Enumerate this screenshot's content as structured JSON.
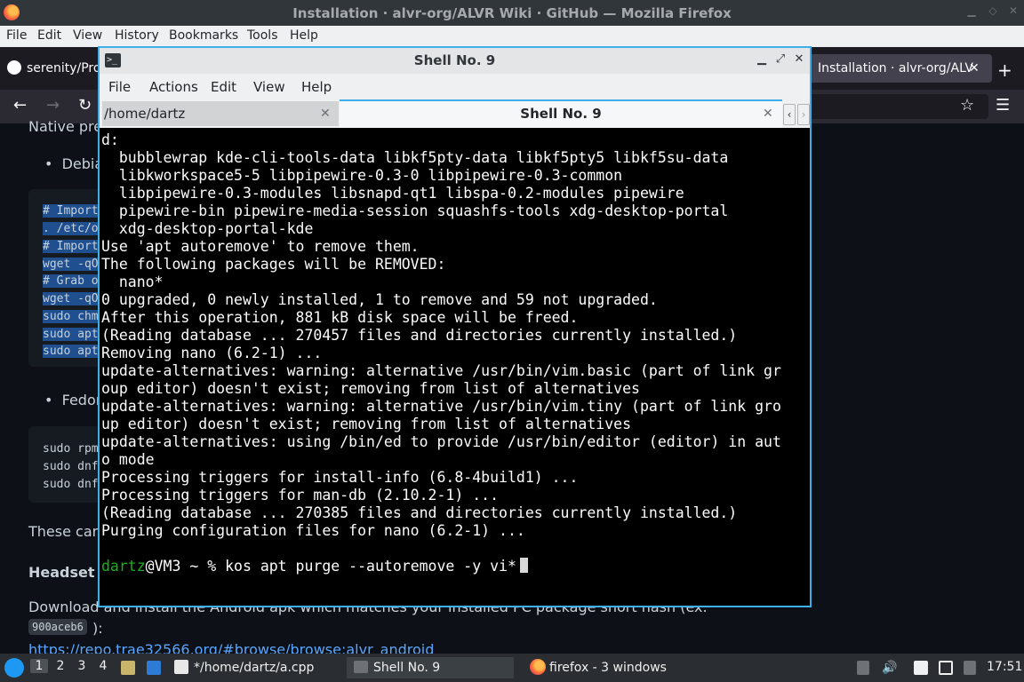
{
  "firefox": {
    "title": "Installation · alvr-org/ALVR Wiki · GitHub — Mozilla Firefox",
    "menu": [
      "File",
      "Edit",
      "View",
      "History",
      "Bookmarks",
      "Tools",
      "Help"
    ],
    "tabs": [
      {
        "label": "serenity/Pro"
      },
      {
        "label": "Installation · alvr-org/ALV"
      }
    ],
    "new_tab": "+",
    "content": {
      "native_pre": "Native pre-",
      "debian": "Debian",
      "fedora": "Fedora",
      "these_can": "These can",
      "headset": "Headset",
      "download": "Download and install the Android apk which matches your installed PC package short hash (ex.",
      "hash": "900aceb6",
      "hash_suffix": "):",
      "link": "https://repo.trae32566.org/#browse/browse:alvr_android",
      "debian_code": [
        {
          "text": "# Import",
          "sel": true
        },
        {
          "text": ". /etc/o",
          "sel": true
        },
        {
          "text": "# Import",
          "sel": true
        },
        {
          "text": "wget -qO",
          "sel": true
        },
        {
          "text": "# Grab o",
          "sel": true
        },
        {
          "text": "wget -qO",
          "sel": true
        },
        {
          "text": "sudo chm",
          "sel": true
        },
        {
          "text": "sudo apt",
          "sel": true
        },
        {
          "text": "sudo apt",
          "sel": true
        }
      ],
      "fedora_code": [
        "sudo rpm",
        "sudo dnf",
        "sudo dnf"
      ]
    }
  },
  "konsole": {
    "title": "Shell No. 9",
    "menu": [
      "File",
      "Actions",
      "Edit",
      "View",
      "Help"
    ],
    "tabs": [
      {
        "label": "/home/dartz"
      },
      {
        "label": "Shell No. 9"
      }
    ],
    "terminal_lines": [
      "d:",
      "  bubblewrap kde-cli-tools-data libkf5pty-data libkf5pty5 libkf5su-data",
      "  libkworkspace5-5 libpipewire-0.3-0 libpipewire-0.3-common",
      "  libpipewire-0.3-modules libsnapd-qt1 libspa-0.2-modules pipewire",
      "  pipewire-bin pipewire-media-session squashfs-tools xdg-desktop-portal",
      "  xdg-desktop-portal-kde",
      "Use 'apt autoremove' to remove them.",
      "The following packages will be REMOVED:",
      "  nano*",
      "0 upgraded, 0 newly installed, 1 to remove and 59 not upgraded.",
      "After this operation, 881 kB disk space will be freed.",
      "(Reading database ... 270457 files and directories currently installed.)",
      "Removing nano (6.2-1) ...",
      "update-alternatives: warning: alternative /usr/bin/vim.basic (part of link gr",
      "oup editor) doesn't exist; removing from list of alternatives",
      "update-alternatives: warning: alternative /usr/bin/vim.tiny (part of link gro",
      "up editor) doesn't exist; removing from list of alternatives",
      "update-alternatives: using /bin/ed to provide /usr/bin/editor (editor) in aut",
      "o mode",
      "Processing triggers for install-info (6.8-4build1) ...",
      "Processing triggers for man-db (2.10.2-1) ...",
      "(Reading database ... 270385 files and directories currently installed.)",
      "Purging configuration files for nano (6.2-1) ...",
      ""
    ],
    "prompt_user": "dartz",
    "prompt_rest": "@VM3 ~ % ",
    "command": "kos apt purge --autoremove -y vi*"
  },
  "taskbar": {
    "desktops": [
      "1",
      "2",
      "3",
      "4"
    ],
    "tasks": [
      "*/home/dartz/a.cpp",
      "Shell No. 9",
      "firefox - 3 windows"
    ],
    "clock": "17:51"
  },
  "colors": {
    "accent": "#3daee9",
    "prompt_green": "#18b218",
    "selection_blue": "#1f4f8f"
  }
}
